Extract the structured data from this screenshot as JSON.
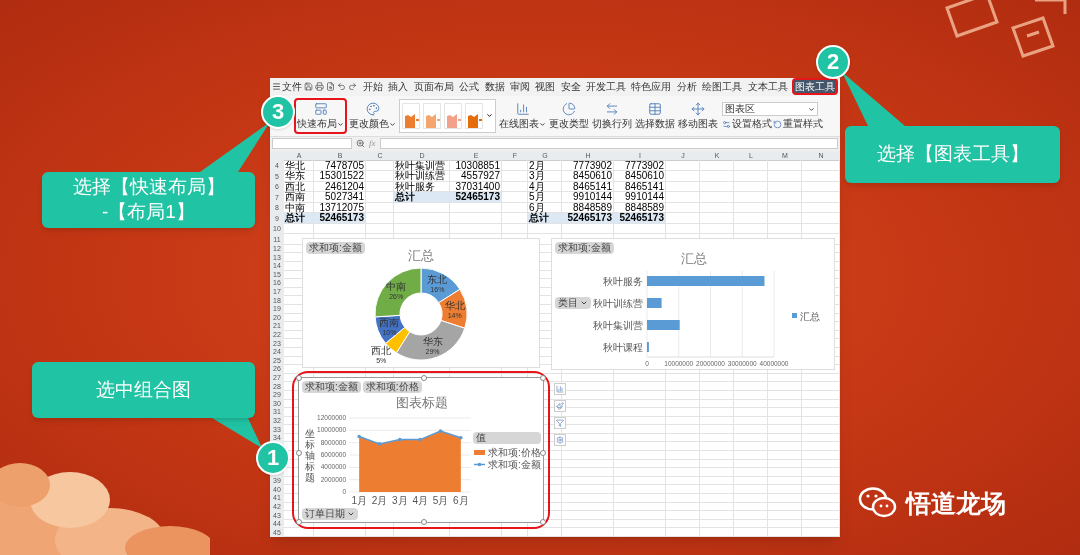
{
  "callouts": [
    {
      "number": "3",
      "lines": [
        "选择【快速布局】",
        "-【布局1】"
      ]
    },
    {
      "number": "2",
      "lines": [
        "选择【图表工具】"
      ]
    },
    {
      "number": "1",
      "lines": [
        "选中组合图"
      ]
    }
  ],
  "app": {
    "file_menu": "文件",
    "menu_tabs": [
      {
        "label": "开始",
        "selected": false,
        "highlighted": false
      },
      {
        "label": "插入",
        "selected": false,
        "highlighted": false
      },
      {
        "label": "页面布局",
        "selected": false,
        "highlighted": false
      },
      {
        "label": "公式",
        "selected": false,
        "highlighted": false
      },
      {
        "label": "数据",
        "selected": false,
        "highlighted": false
      },
      {
        "label": "审阅",
        "selected": false,
        "highlighted": false
      },
      {
        "label": "视图",
        "selected": false,
        "highlighted": false
      },
      {
        "label": "安全",
        "selected": false,
        "highlighted": false
      },
      {
        "label": "开发工具",
        "selected": false,
        "highlighted": false
      },
      {
        "label": "特色应用",
        "selected": false,
        "highlighted": false
      },
      {
        "label": "分析",
        "selected": false,
        "highlighted": false
      },
      {
        "label": "绘图工具",
        "selected": false,
        "highlighted": false
      },
      {
        "label": "文本工具",
        "selected": false,
        "highlighted": false
      },
      {
        "label": "图表工具",
        "selected": true,
        "highlighted": true
      }
    ],
    "ribbon": [
      {
        "kind": "button",
        "label": "快速布局",
        "dropdown": true,
        "highlighted": true
      },
      {
        "kind": "button",
        "label": "更改颜色",
        "dropdown": true,
        "highlighted": false
      },
      {
        "kind": "gallery",
        "styles": [
          {
            "color": "#ed7d31"
          },
          {
            "color": "#f4a66e"
          },
          {
            "color": "#f2a28a"
          },
          {
            "color": "#e46c0a"
          }
        ]
      },
      {
        "kind": "button",
        "label": "在线图表",
        "dropdown": true,
        "highlighted": false
      },
      {
        "kind": "button",
        "label": "更改类型",
        "dropdown": false,
        "highlighted": false
      },
      {
        "kind": "button",
        "label": "切换行列",
        "dropdown": false,
        "highlighted": false
      },
      {
        "kind": "button",
        "label": "选择数据",
        "dropdown": false,
        "highlighted": false
      },
      {
        "kind": "button",
        "label": "移动图表",
        "dropdown": false,
        "highlighted": false
      },
      {
        "kind": "element_picker",
        "value": "图表区",
        "actions": [
          "设置格式",
          "重置样式"
        ]
      }
    ],
    "formula_bar": {
      "fx": "fx"
    },
    "sheet": {
      "columns": [
        "A",
        "B",
        "C",
        "D",
        "E",
        "F",
        "G",
        "H",
        "I",
        "J",
        "K",
        "L",
        "M",
        "N"
      ],
      "rows": [
        {
          "number": "4",
          "cells": {
            "A": {
              "text": "华北",
              "kind": "text",
              "total": false
            },
            "B": {
              "text": "7478705",
              "kind": "number",
              "total": false
            },
            "D": {
              "text": "秋叶集训营",
              "kind": "text",
              "total": false
            },
            "E": {
              "text": "10308851",
              "kind": "number",
              "total": false
            },
            "G": {
              "text": "2月",
              "kind": "text",
              "total": false
            },
            "H": {
              "text": "7773902",
              "kind": "number",
              "total": false
            },
            "I": {
              "text": "7773902",
              "kind": "number",
              "total": false
            }
          }
        },
        {
          "number": "5",
          "cells": {
            "A": {
              "text": "华东",
              "kind": "text",
              "total": false
            },
            "B": {
              "text": "15301522",
              "kind": "number",
              "total": false
            },
            "D": {
              "text": "秋叶训练营",
              "kind": "text",
              "total": false
            },
            "E": {
              "text": "4557927",
              "kind": "number",
              "total": false
            },
            "G": {
              "text": "3月",
              "kind": "text",
              "total": false
            },
            "H": {
              "text": "8450610",
              "kind": "number",
              "total": false
            },
            "I": {
              "text": "8450610",
              "kind": "number",
              "total": false
            }
          }
        },
        {
          "number": "6",
          "cells": {
            "A": {
              "text": "西北",
              "kind": "text",
              "total": false
            },
            "B": {
              "text": "2461204",
              "kind": "number",
              "total": false
            },
            "D": {
              "text": "秋叶服务",
              "kind": "text",
              "total": false
            },
            "E": {
              "text": "37031400",
              "kind": "number",
              "total": false
            },
            "G": {
              "text": "4月",
              "kind": "text",
              "total": false
            },
            "H": {
              "text": "8465141",
              "kind": "number",
              "total": false
            },
            "I": {
              "text": "8465141",
              "kind": "number",
              "total": false
            }
          }
        },
        {
          "number": "7",
          "cells": {
            "A": {
              "text": "西南",
              "kind": "text",
              "total": false
            },
            "B": {
              "text": "5027341",
              "kind": "number",
              "total": false
            },
            "D": {
              "text": "总计",
              "kind": "text",
              "total": true
            },
            "E": {
              "text": "52465173",
              "kind": "number",
              "total": true
            },
            "G": {
              "text": "5月",
              "kind": "text",
              "total": false
            },
            "H": {
              "text": "9910144",
              "kind": "number",
              "total": false
            },
            "I": {
              "text": "9910144",
              "kind": "number",
              "total": false
            }
          }
        },
        {
          "number": "8",
          "cells": {
            "A": {
              "text": "中南",
              "kind": "text",
              "total": false
            },
            "B": {
              "text": "13712075",
              "kind": "number",
              "total": false
            },
            "G": {
              "text": "6月",
              "kind": "text",
              "total": false
            },
            "H": {
              "text": "8848589",
              "kind": "number",
              "total": false
            },
            "I": {
              "text": "8848589",
              "kind": "number",
              "total": false
            }
          }
        },
        {
          "number": "9",
          "cells": {
            "A": {
              "text": "总计",
              "kind": "text",
              "total": true
            },
            "B": {
              "text": "52465173",
              "kind": "number",
              "total": true
            },
            "G": {
              "text": "总计",
              "kind": "text",
              "total": true
            },
            "H": {
              "text": "52465173",
              "kind": "number",
              "total": true
            },
            "I": {
              "text": "52465173",
              "kind": "number",
              "total": true
            }
          }
        },
        {
          "number": "10"
        },
        {
          "number": "11"
        },
        {
          "number": "12"
        },
        {
          "number": "13"
        },
        {
          "number": "14"
        },
        {
          "number": "15"
        },
        {
          "number": "16"
        },
        {
          "number": "17"
        },
        {
          "number": "18"
        },
        {
          "number": "19"
        },
        {
          "number": "20"
        },
        {
          "number": "21"
        },
        {
          "number": "22"
        },
        {
          "number": "23"
        },
        {
          "number": "24"
        },
        {
          "number": "25"
        },
        {
          "number": "26"
        },
        {
          "number": "27"
        },
        {
          "number": "28"
        },
        {
          "number": "29"
        },
        {
          "number": "30"
        },
        {
          "number": "31"
        },
        {
          "number": "32"
        },
        {
          "number": "33"
        },
        {
          "number": "34"
        },
        {},
        {},
        {},
        {},
        {
          "number": "39"
        },
        {
          "number": "40"
        },
        {
          "number": "41"
        },
        {
          "number": "42"
        },
        {
          "number": "43"
        },
        {
          "number": "44"
        },
        {
          "number": "45"
        }
      ]
    },
    "charts": [
      {
        "selected": false,
        "highlighted": false,
        "field_buttons": [
          {
            "label": "求和项:金额",
            "kind": "value",
            "dropdown": false
          }
        ],
        "chart_data": {
          "type": "donut",
          "title": "汇总",
          "categories": [
            "东北",
            "华北",
            "华东",
            "西北",
            "西南",
            "中南"
          ],
          "values": [
            16,
            14,
            29,
            5,
            10,
            26
          ],
          "colors": [
            "#5b9bd5",
            "#ed7d31",
            "#a5a5a5",
            "#ffc000",
            "#4472c4",
            "#70ad47"
          ],
          "data_labels": "value_labels",
          "value_labels": [
            "16%",
            "14%",
            "29%",
            "5%",
            "10%",
            "26%"
          ]
        }
      },
      {
        "selected": false,
        "highlighted": false,
        "field_buttons": [
          {
            "label": "求和项:金额",
            "kind": "value",
            "dropdown": false
          },
          {
            "label": "类目",
            "kind": "category",
            "dropdown": true
          }
        ],
        "chart_data": {
          "type": "bar",
          "orientation": "horizontal",
          "title": "汇总",
          "grid": true,
          "categories": [
            "秋叶服务",
            "秋叶训练营",
            "秋叶集训营",
            "秋叶课程"
          ],
          "series": [
            {
              "name": "汇总",
              "color": "#5b9bd5",
              "values": [
                37000000,
                4600000,
                10300000,
                600000
              ]
            }
          ],
          "xlim": [
            0,
            40000000
          ],
          "xticks": [
            0,
            10000000,
            20000000,
            30000000,
            40000000
          ],
          "legend": true
        }
      },
      {
        "selected": true,
        "highlighted": true,
        "field_buttons": [
          {
            "label": "求和项:金额",
            "kind": "value",
            "dropdown": false
          },
          {
            "label": "求和项:价格",
            "kind": "value",
            "dropdown": false
          },
          {
            "label": "订单日期",
            "kind": "category",
            "dropdown": true
          },
          {
            "label": "值",
            "kind": "legend",
            "dropdown": false
          }
        ],
        "chart_data": {
          "type": "area",
          "title": "图表标题",
          "ylabel": "坐标轴标题",
          "grid": true,
          "categories": [
            "1月",
            "2月",
            "3月",
            "4月",
            "5月",
            "6月"
          ],
          "series": [
            {
              "name": "求和项:价格",
              "type": "area",
              "color": "#ed7d31",
              "values": [
                9000000,
                7800000,
                8500000,
                8500000,
                9900000,
                8800000
              ]
            },
            {
              "name": "求和项:金额",
              "type": "line",
              "color": "#5b9bd5",
              "values": [
                9000000,
                7800000,
                8500000,
                8500000,
                9900000,
                8800000
              ]
            }
          ],
          "legend": true,
          "ylim": [
            0,
            12000000
          ],
          "yticks": [
            0,
            2000000,
            4000000,
            6000000,
            8000000,
            10000000,
            12000000
          ]
        }
      }
    ]
  },
  "brand": {
    "name": "悟道龙场"
  }
}
